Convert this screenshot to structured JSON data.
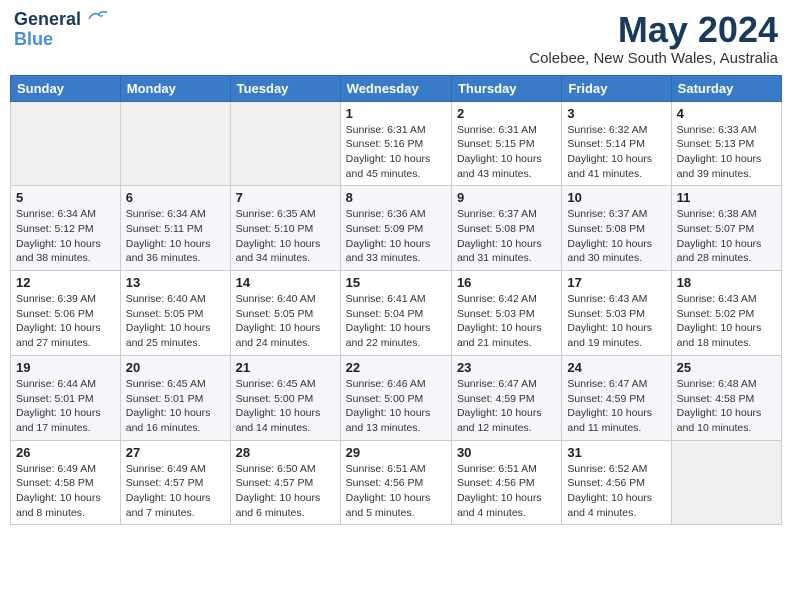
{
  "header": {
    "logo_line1": "General",
    "logo_line2": "Blue",
    "main_title": "May 2024",
    "subtitle": "Colebee, New South Wales, Australia"
  },
  "days_of_week": [
    "Sunday",
    "Monday",
    "Tuesday",
    "Wednesday",
    "Thursday",
    "Friday",
    "Saturday"
  ],
  "weeks": [
    [
      {
        "day": "",
        "info": ""
      },
      {
        "day": "",
        "info": ""
      },
      {
        "day": "",
        "info": ""
      },
      {
        "day": "1",
        "info": "Sunrise: 6:31 AM\nSunset: 5:16 PM\nDaylight: 10 hours\nand 45 minutes."
      },
      {
        "day": "2",
        "info": "Sunrise: 6:31 AM\nSunset: 5:15 PM\nDaylight: 10 hours\nand 43 minutes."
      },
      {
        "day": "3",
        "info": "Sunrise: 6:32 AM\nSunset: 5:14 PM\nDaylight: 10 hours\nand 41 minutes."
      },
      {
        "day": "4",
        "info": "Sunrise: 6:33 AM\nSunset: 5:13 PM\nDaylight: 10 hours\nand 39 minutes."
      }
    ],
    [
      {
        "day": "5",
        "info": "Sunrise: 6:34 AM\nSunset: 5:12 PM\nDaylight: 10 hours\nand 38 minutes."
      },
      {
        "day": "6",
        "info": "Sunrise: 6:34 AM\nSunset: 5:11 PM\nDaylight: 10 hours\nand 36 minutes."
      },
      {
        "day": "7",
        "info": "Sunrise: 6:35 AM\nSunset: 5:10 PM\nDaylight: 10 hours\nand 34 minutes."
      },
      {
        "day": "8",
        "info": "Sunrise: 6:36 AM\nSunset: 5:09 PM\nDaylight: 10 hours\nand 33 minutes."
      },
      {
        "day": "9",
        "info": "Sunrise: 6:37 AM\nSunset: 5:08 PM\nDaylight: 10 hours\nand 31 minutes."
      },
      {
        "day": "10",
        "info": "Sunrise: 6:37 AM\nSunset: 5:08 PM\nDaylight: 10 hours\nand 30 minutes."
      },
      {
        "day": "11",
        "info": "Sunrise: 6:38 AM\nSunset: 5:07 PM\nDaylight: 10 hours\nand 28 minutes."
      }
    ],
    [
      {
        "day": "12",
        "info": "Sunrise: 6:39 AM\nSunset: 5:06 PM\nDaylight: 10 hours\nand 27 minutes."
      },
      {
        "day": "13",
        "info": "Sunrise: 6:40 AM\nSunset: 5:05 PM\nDaylight: 10 hours\nand 25 minutes."
      },
      {
        "day": "14",
        "info": "Sunrise: 6:40 AM\nSunset: 5:05 PM\nDaylight: 10 hours\nand 24 minutes."
      },
      {
        "day": "15",
        "info": "Sunrise: 6:41 AM\nSunset: 5:04 PM\nDaylight: 10 hours\nand 22 minutes."
      },
      {
        "day": "16",
        "info": "Sunrise: 6:42 AM\nSunset: 5:03 PM\nDaylight: 10 hours\nand 21 minutes."
      },
      {
        "day": "17",
        "info": "Sunrise: 6:43 AM\nSunset: 5:03 PM\nDaylight: 10 hours\nand 19 minutes."
      },
      {
        "day": "18",
        "info": "Sunrise: 6:43 AM\nSunset: 5:02 PM\nDaylight: 10 hours\nand 18 minutes."
      }
    ],
    [
      {
        "day": "19",
        "info": "Sunrise: 6:44 AM\nSunset: 5:01 PM\nDaylight: 10 hours\nand 17 minutes."
      },
      {
        "day": "20",
        "info": "Sunrise: 6:45 AM\nSunset: 5:01 PM\nDaylight: 10 hours\nand 16 minutes."
      },
      {
        "day": "21",
        "info": "Sunrise: 6:45 AM\nSunset: 5:00 PM\nDaylight: 10 hours\nand 14 minutes."
      },
      {
        "day": "22",
        "info": "Sunrise: 6:46 AM\nSunset: 5:00 PM\nDaylight: 10 hours\nand 13 minutes."
      },
      {
        "day": "23",
        "info": "Sunrise: 6:47 AM\nSunset: 4:59 PM\nDaylight: 10 hours\nand 12 minutes."
      },
      {
        "day": "24",
        "info": "Sunrise: 6:47 AM\nSunset: 4:59 PM\nDaylight: 10 hours\nand 11 minutes."
      },
      {
        "day": "25",
        "info": "Sunrise: 6:48 AM\nSunset: 4:58 PM\nDaylight: 10 hours\nand 10 minutes."
      }
    ],
    [
      {
        "day": "26",
        "info": "Sunrise: 6:49 AM\nSunset: 4:58 PM\nDaylight: 10 hours\nand 8 minutes."
      },
      {
        "day": "27",
        "info": "Sunrise: 6:49 AM\nSunset: 4:57 PM\nDaylight: 10 hours\nand 7 minutes."
      },
      {
        "day": "28",
        "info": "Sunrise: 6:50 AM\nSunset: 4:57 PM\nDaylight: 10 hours\nand 6 minutes."
      },
      {
        "day": "29",
        "info": "Sunrise: 6:51 AM\nSunset: 4:56 PM\nDaylight: 10 hours\nand 5 minutes."
      },
      {
        "day": "30",
        "info": "Sunrise: 6:51 AM\nSunset: 4:56 PM\nDaylight: 10 hours\nand 4 minutes."
      },
      {
        "day": "31",
        "info": "Sunrise: 6:52 AM\nSunset: 4:56 PM\nDaylight: 10 hours\nand 4 minutes."
      },
      {
        "day": "",
        "info": ""
      }
    ]
  ]
}
